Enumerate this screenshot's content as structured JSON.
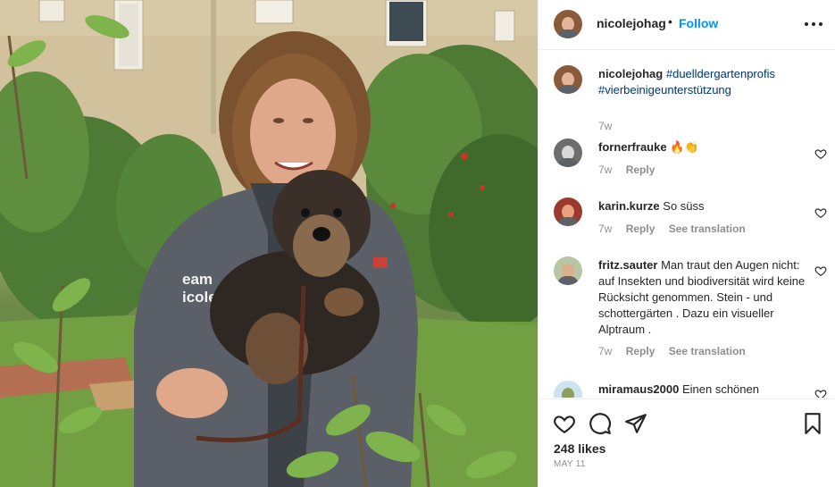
{
  "post": {
    "username": "nicolejohag",
    "separator": "•",
    "follow_label": "Follow",
    "more_icon": "more-horizontal-icon",
    "photo_text_line1": "eam",
    "photo_text_line2": "icole"
  },
  "caption": {
    "username": "nicolejohag",
    "hashtag1": "#duelldergartenprofis",
    "hashtag2": "#vierbeinigeunterstützung",
    "time": "7w"
  },
  "comments": [
    {
      "username": "fornerfrauke",
      "text": "🔥👏",
      "time": "7w",
      "reply": "Reply"
    },
    {
      "username": "karin.kurze",
      "text": "So süss",
      "time": "7w",
      "reply": "Reply",
      "translate": "See translation"
    },
    {
      "username": "fritz.sauter",
      "text": "Man traut den Augen nicht: auf Insekten und biodiversität wird keine Rücksicht genommen. Stein - und schottergärten . Dazu ein visueller Alptraum .",
      "time": "7w",
      "reply": "Reply",
      "translate": "See translation"
    },
    {
      "username": "miramaus2000",
      "text": "Einen schönen"
    }
  ],
  "actions": {
    "like_icon": "heart-icon",
    "comment_icon": "comment-icon",
    "share_icon": "share-icon",
    "save_icon": "bookmark-icon",
    "likes": "248 likes",
    "date": "MAY 11"
  },
  "colors": {
    "accent": "#0095f6",
    "hashtag": "#00376b",
    "secondary": "#8e8e8e"
  }
}
